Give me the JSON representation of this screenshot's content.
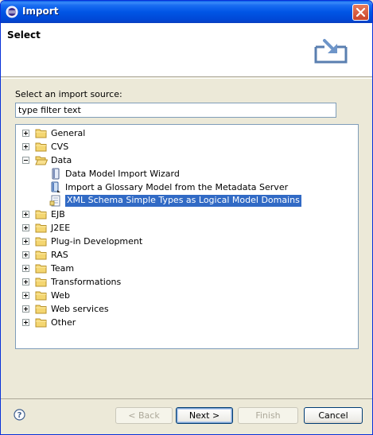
{
  "window": {
    "title": "Import"
  },
  "banner": {
    "heading": "Select"
  },
  "source": {
    "label": "Select an import source:",
    "filter_value": "type filter text"
  },
  "tree": {
    "items": [
      {
        "label": "General",
        "kind": "folder",
        "expander": "plus",
        "level": 0,
        "selected": false
      },
      {
        "label": "CVS",
        "kind": "folder",
        "expander": "plus",
        "level": 0,
        "selected": false
      },
      {
        "label": "Data",
        "kind": "folder-open",
        "expander": "minus",
        "level": 0,
        "selected": false
      },
      {
        "label": "Data Model Import Wizard",
        "kind": "data-model-icon",
        "expander": "none",
        "level": 1,
        "selected": false
      },
      {
        "label": "Import a Glossary Model from the Metadata Server",
        "kind": "glossary-icon",
        "expander": "none",
        "level": 1,
        "selected": false
      },
      {
        "label": "XML Schema Simple Types as Logical Model Domains",
        "kind": "xml-schema-icon",
        "expander": "none",
        "level": 1,
        "selected": true
      },
      {
        "label": "EJB",
        "kind": "folder",
        "expander": "plus",
        "level": 0,
        "selected": false
      },
      {
        "label": "J2EE",
        "kind": "folder",
        "expander": "plus",
        "level": 0,
        "selected": false
      },
      {
        "label": "Plug-in Development",
        "kind": "folder",
        "expander": "plus",
        "level": 0,
        "selected": false
      },
      {
        "label": "RAS",
        "kind": "folder",
        "expander": "plus",
        "level": 0,
        "selected": false
      },
      {
        "label": "Team",
        "kind": "folder",
        "expander": "plus",
        "level": 0,
        "selected": false
      },
      {
        "label": "Transformations",
        "kind": "folder",
        "expander": "plus",
        "level": 0,
        "selected": false
      },
      {
        "label": "Web",
        "kind": "folder",
        "expander": "plus",
        "level": 0,
        "selected": false
      },
      {
        "label": "Web services",
        "kind": "folder",
        "expander": "plus",
        "level": 0,
        "selected": false
      },
      {
        "label": "Other",
        "kind": "folder",
        "expander": "plus",
        "level": 0,
        "selected": false
      }
    ]
  },
  "buttons": {
    "back": "< Back",
    "next": "Next >",
    "finish": "Finish",
    "cancel": "Cancel"
  },
  "colors": {
    "selection": "#316AC5",
    "titlebar": "#0055E5",
    "folder": "#F4D671"
  }
}
